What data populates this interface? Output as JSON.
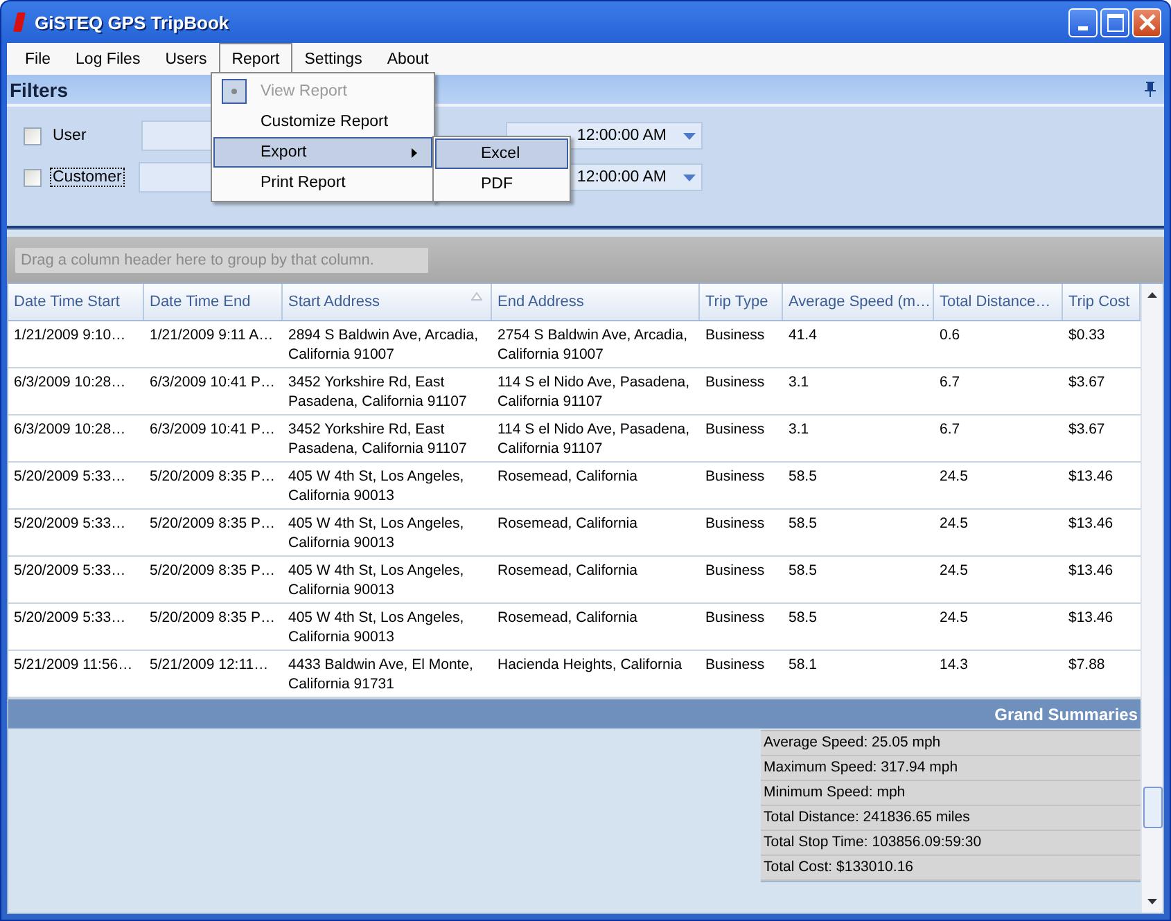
{
  "window": {
    "title": "GiSTEQ GPS TripBook"
  },
  "menu": [
    {
      "label": "File",
      "selected": false
    },
    {
      "label": "Log Files",
      "selected": false
    },
    {
      "label": "Users",
      "selected": false
    },
    {
      "label": "Report",
      "selected": true
    },
    {
      "label": "Settings",
      "selected": false
    },
    {
      "label": "About",
      "selected": false
    }
  ],
  "report_menu": [
    {
      "label": "View Report",
      "disabled": true,
      "highlighted": false,
      "submenu": false,
      "checked": true
    },
    {
      "label": "Customize Report",
      "disabled": false,
      "highlighted": false,
      "submenu": false,
      "checked": false
    },
    {
      "label": "Export",
      "disabled": false,
      "highlighted": true,
      "submenu": true,
      "checked": false
    },
    {
      "label": "Print Report",
      "disabled": false,
      "highlighted": false,
      "submenu": false,
      "checked": false
    }
  ],
  "export_menu": [
    {
      "label": "Excel",
      "highlighted": true
    },
    {
      "label": "PDF",
      "highlighted": false
    }
  ],
  "filters": {
    "title": "Filters",
    "rows": [
      {
        "label": "User",
        "checked": false,
        "focused": false,
        "date": "12:00:00 AM"
      },
      {
        "label": "Customer",
        "checked": false,
        "focused": true,
        "date": "12:00:00 AM"
      }
    ]
  },
  "grid": {
    "group_hint": "Drag a column header here to group by that column.",
    "columns": [
      {
        "label": "Date Time Start",
        "sorted": false
      },
      {
        "label": "Date Time End",
        "sorted": false
      },
      {
        "label": "Start Address",
        "sorted": true
      },
      {
        "label": "End Address",
        "sorted": false
      },
      {
        "label": "Trip Type",
        "sorted": false
      },
      {
        "label": "Average Speed (m…",
        "sorted": false
      },
      {
        "label": "Total Distance…",
        "sorted": false
      },
      {
        "label": "Trip Cost",
        "sorted": false
      }
    ],
    "rows": [
      [
        "1/21/2009 9:10…",
        "1/21/2009 9:11 A…",
        "2894 S Baldwin Ave, Arcadia, California 91007",
        "2754 S Baldwin Ave, Arcadia, California 91007",
        "Business",
        "41.4",
        "0.6",
        "$0.33"
      ],
      [
        "6/3/2009 10:28…",
        "6/3/2009 10:41 P…",
        "3452 Yorkshire Rd, East Pasadena, California 91107",
        "114 S el Nido Ave, Pasadena, California 91107",
        "Business",
        "3.1",
        "6.7",
        "$3.67"
      ],
      [
        "6/3/2009 10:28…",
        "6/3/2009 10:41 P…",
        "3452 Yorkshire Rd, East Pasadena, California 91107",
        "114 S el Nido Ave, Pasadena, California 91107",
        "Business",
        "3.1",
        "6.7",
        "$3.67"
      ],
      [
        "5/20/2009 5:33…",
        "5/20/2009 8:35 P…",
        "405 W 4th St, Los Angeles, California 90013",
        "Rosemead, California",
        "Business",
        "58.5",
        "24.5",
        "$13.46"
      ],
      [
        "5/20/2009 5:33…",
        "5/20/2009 8:35 P…",
        "405 W 4th St, Los Angeles, California 90013",
        "Rosemead, California",
        "Business",
        "58.5",
        "24.5",
        "$13.46"
      ],
      [
        "5/20/2009 5:33…",
        "5/20/2009 8:35 P…",
        "405 W 4th St, Los Angeles, California 90013",
        "Rosemead, California",
        "Business",
        "58.5",
        "24.5",
        "$13.46"
      ],
      [
        "5/20/2009 5:33…",
        "5/20/2009 8:35 P…",
        "405 W 4th St, Los Angeles, California 90013",
        "Rosemead, California",
        "Business",
        "58.5",
        "24.5",
        "$13.46"
      ],
      [
        "5/21/2009 11:56…",
        "5/21/2009 12:11…",
        "4433 Baldwin Ave, El Monte, California 91731",
        "Hacienda Heights, California",
        "Business",
        "58.1",
        "14.3",
        "$7.88"
      ]
    ]
  },
  "summaries": {
    "title": "Grand Summaries",
    "lines": [
      "Average Speed: 25.05 mph",
      "Maximum Speed: 317.94 mph",
      "Minimum Speed:  mph",
      "Total Distance: 241836.65 miles",
      "Total Stop Time: 103856.09:59:30",
      "Total Cost: $133010.16"
    ]
  }
}
